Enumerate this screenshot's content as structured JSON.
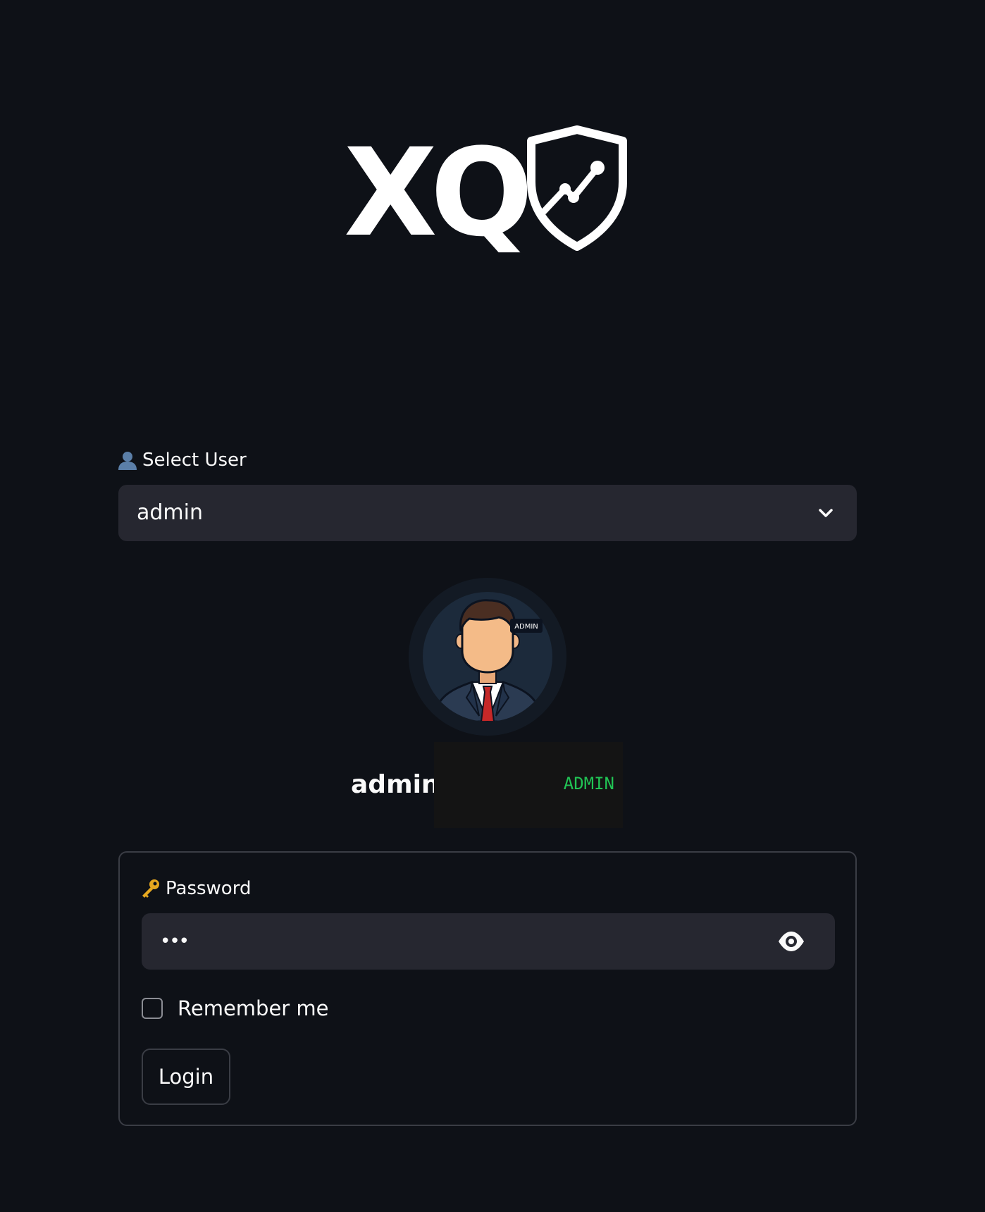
{
  "logo": {
    "text": "XQ",
    "icon": "shield-chart-icon"
  },
  "user_select": {
    "label_icon": "user-icon",
    "label": "Select User",
    "selected_value": "admin",
    "dropdown_icon": "chevron-down-icon"
  },
  "profile": {
    "avatar_icon": "businessman-avatar-icon",
    "avatar_badge": "ADMIN",
    "name": "admin",
    "role": "ADMIN",
    "role_color": "#21c354"
  },
  "login_form": {
    "password_label_icon": "key-icon",
    "password_label": "Password",
    "password_value": "•••",
    "toggle_visibility_icon": "eye-icon",
    "remember_label": "Remember me",
    "remember_checked": false,
    "login_label": "Login"
  },
  "colors": {
    "background": "#0e1117",
    "input_background": "#262730",
    "border": "#3a3d45",
    "text": "#fafafa"
  }
}
